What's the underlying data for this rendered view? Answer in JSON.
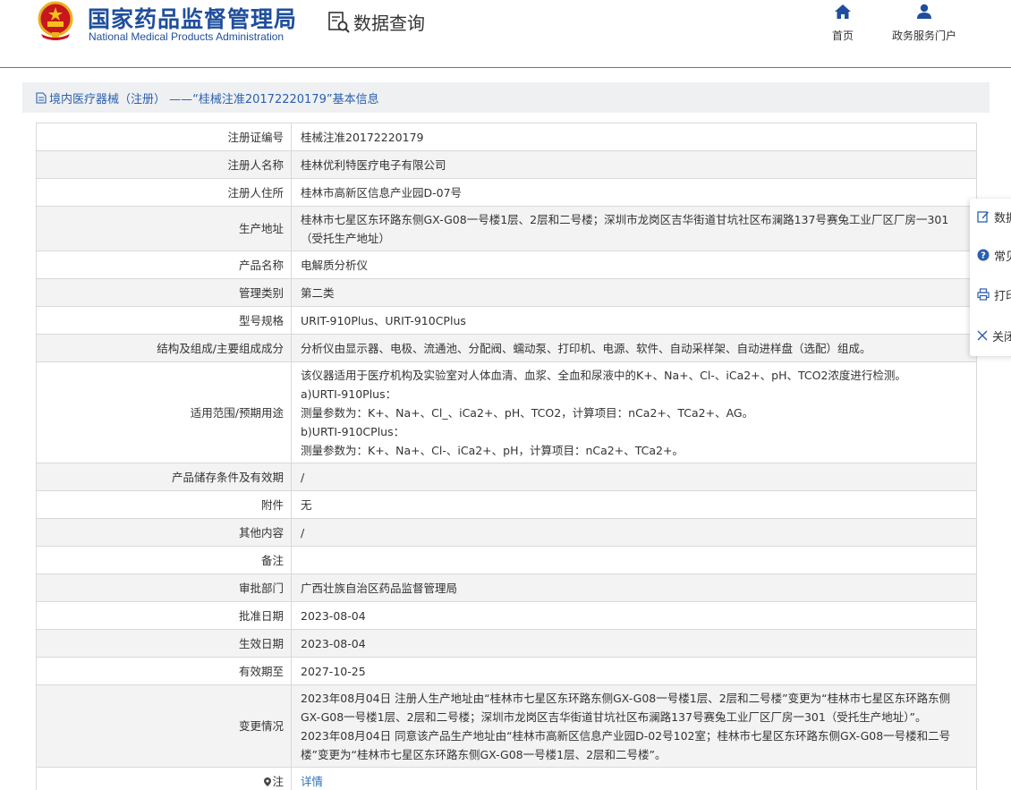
{
  "header": {
    "org_name_cn": "国家药品监督管理局",
    "org_name_en": "National Medical Products Administration",
    "data_query_label": "数据查询",
    "nav": [
      {
        "label": "首页",
        "icon": "home-icon"
      },
      {
        "label": "政务服务门户",
        "icon": "user-icon"
      }
    ]
  },
  "panel": {
    "title": "境内医疗器械（注册） ——“桂械注准20172220179”基本信息"
  },
  "rows": [
    {
      "label": "注册证编号",
      "value": "桂械注准20172220179"
    },
    {
      "label": "注册人名称",
      "value": "桂林优利特医疗电子有限公司"
    },
    {
      "label": "注册人住所",
      "value": "桂林市高新区信息产业园D-07号"
    },
    {
      "label": "生产地址",
      "lines": [
        "桂林市七星区东环路东侧GX-G08一号楼1层、2层和二号楼；深圳市龙岗区吉华街道甘坑社区布澜路137号赛兔工业厂区厂房一301",
        "（受托生产地址）"
      ]
    },
    {
      "label": "产品名称",
      "value": "电解质分析仪"
    },
    {
      "label": "管理类别",
      "value": "第二类"
    },
    {
      "label": "型号规格",
      "value": "URIT-910Plus、URIT-910CPlus"
    },
    {
      "label": "结构及组成/主要组成成分",
      "value": "分析仪由显示器、电极、流通池、分配阀、蠕动泵、打印机、电源、软件、自动采样架、自动进样盘（选配）组成。"
    },
    {
      "label": "适用范围/预期用途",
      "lines": [
        "该仪器适用于医疗机构及实验室对人体血清、血浆、全血和尿液中的K+、Na+、Cl-、iCa2+、pH、TCO2浓度进行检测。",
        "a)URTI-910Plus：",
        "测量参数为：K+、Na+、Cl_、iCa2+、pH、TCO2，计算项目：nCa2+、TCa2+、AG。",
        "b)URTI-910CPlus：",
        "测量参数为：K+、Na+、Cl-、iCa2+、pH，计算项目：nCa2+、TCa2+。"
      ]
    },
    {
      "label": "产品储存条件及有效期",
      "value": "/"
    },
    {
      "label": "附件",
      "value": "无"
    },
    {
      "label": "其他内容",
      "value": "/"
    },
    {
      "label": "备注",
      "value": ""
    },
    {
      "label": "审批部门",
      "value": "广西壮族自治区药品监督管理局"
    },
    {
      "label": "批准日期",
      "value": "2023-08-04"
    },
    {
      "label": "生效日期",
      "value": "2023-08-04"
    },
    {
      "label": "有效期至",
      "value": "2027-10-25"
    },
    {
      "label": "变更情况",
      "lines": [
        "2023年08月04日 注册人生产地址由“桂林市七星区东环路东侧GX-G08一号楼1层、2层和二号楼”变更为“桂林市七星区东环路东侧",
        "GX-G08一号楼1层、2层和二号楼；深圳市龙岗区吉华街道甘坑社区布澜路137号赛兔工业厂区厂房一301（受托生产地址）”。",
        "2023年08月04日 同意该产品生产地址由“桂林市高新区信息产业园D-02号102室；桂林市七星区东环路东侧GX-G08一号楼和二号",
        "楼”变更为“桂林市七星区东环路东侧GX-G08一号楼1层、2层和二号楼”。"
      ]
    },
    {
      "label": "注",
      "value": "详情",
      "link": true
    }
  ],
  "float_toolbar": [
    {
      "label": "数据",
      "icon": "edit-icon"
    },
    {
      "label": "常见",
      "icon": "help-icon"
    },
    {
      "label": "打印",
      "icon": "print-icon"
    },
    {
      "label": "关闭",
      "icon": "close-icon"
    }
  ]
}
